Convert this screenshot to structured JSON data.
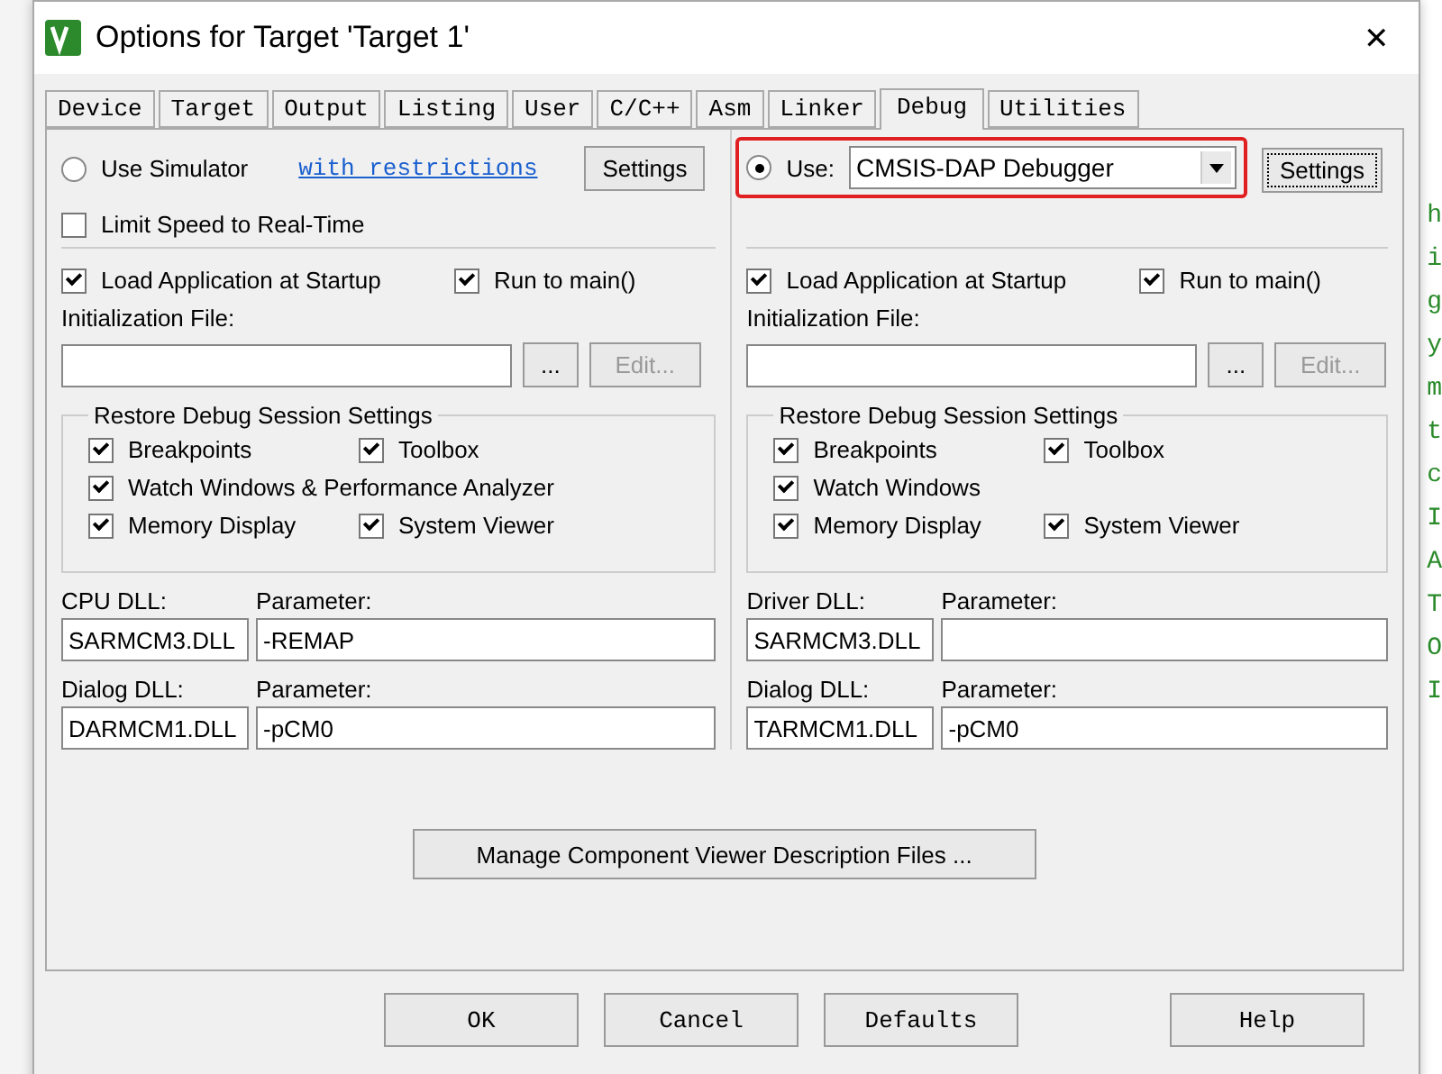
{
  "window": {
    "title": "Options for Target 'Target 1'",
    "close": "✕"
  },
  "tabs": [
    {
      "label": "Device",
      "selected": false
    },
    {
      "label": "Target",
      "selected": false
    },
    {
      "label": "Output",
      "selected": false
    },
    {
      "label": "Listing",
      "selected": false
    },
    {
      "label": "User",
      "selected": false
    },
    {
      "label": "C/C++",
      "selected": false
    },
    {
      "label": "Asm",
      "selected": false
    },
    {
      "label": "Linker",
      "selected": false
    },
    {
      "label": "Debug",
      "selected": true
    },
    {
      "label": "Utilities",
      "selected": false
    }
  ],
  "panels": [
    {
      "selector": {
        "kind": "simulator",
        "label": "Use Simulator",
        "selected": false,
        "link": "with restrictions",
        "button": "Settings"
      },
      "limit_speed": {
        "label": "Limit Speed to Real-Time",
        "checked": false
      },
      "load_application": {
        "label": "Load Application at Startup",
        "checked": true
      },
      "run_to_main": {
        "label": "Run to main()",
        "checked": true
      },
      "init_file": {
        "label": "Initialization File:",
        "browse": "...",
        "edit": "Edit...",
        "edit_disabled": true
      },
      "restore": {
        "title": "Restore Debug Session Settings",
        "items": [
          {
            "label": "Breakpoints",
            "checked": true,
            "kind": "half"
          },
          {
            "label": "Toolbox",
            "checked": true,
            "kind": "half"
          },
          {
            "label": "Watch Windows & Performance Analyzer",
            "checked": true,
            "kind": "full"
          },
          {
            "label": "Memory Display",
            "checked": true,
            "kind": "half"
          },
          {
            "label": "System Viewer",
            "checked": true,
            "kind": "half"
          }
        ]
      },
      "dll_rows": [
        {
          "dll_label": "CPU DLL:",
          "param_label": "Parameter:",
          "dll": "SARMCM3.DLL",
          "param": "-REMAP"
        },
        {
          "dll_label": "Dialog DLL:",
          "param_label": "Parameter:",
          "dll": "DARMCM1.DLL",
          "param": "-pCM0"
        }
      ]
    },
    {
      "selector": {
        "kind": "driver",
        "label": "Use:",
        "selected": true,
        "value": "CMSIS-DAP Debugger",
        "button": "Settings",
        "highlighted": true
      },
      "load_application": {
        "label": "Load Application at Startup",
        "checked": true
      },
      "run_to_main": {
        "label": "Run to main()",
        "checked": true
      },
      "init_file": {
        "label": "Initialization File:",
        "browse": "...",
        "edit": "Edit...",
        "edit_disabled": true
      },
      "restore": {
        "title": "Restore Debug Session Settings",
        "items": [
          {
            "label": "Breakpoints",
            "checked": true,
            "kind": "half"
          },
          {
            "label": "Toolbox",
            "checked": true,
            "kind": "half"
          },
          {
            "label": "Watch Windows",
            "checked": true,
            "kind": "full"
          },
          {
            "label": "Memory Display",
            "checked": true,
            "kind": "half"
          },
          {
            "label": "System Viewer",
            "checked": true,
            "kind": "half"
          }
        ]
      },
      "dll_rows": [
        {
          "dll_label": "Driver DLL:",
          "param_label": "Parameter:",
          "dll": "SARMCM3.DLL",
          "param": ""
        },
        {
          "dll_label": "Dialog DLL:",
          "param_label": "Parameter:",
          "dll": "TARMCM1.DLL",
          "param": "-pCM0"
        }
      ]
    }
  ],
  "manage_button": "Manage Component Viewer Description Files ...",
  "buttons": [
    "OK",
    "Cancel",
    "Defaults",
    "Help"
  ],
  "background_code": [
    "h",
    "i",
    "g",
    "y",
    "m",
    "t",
    "c",
    "I",
    "A",
    "T",
    "O",
    "I"
  ]
}
